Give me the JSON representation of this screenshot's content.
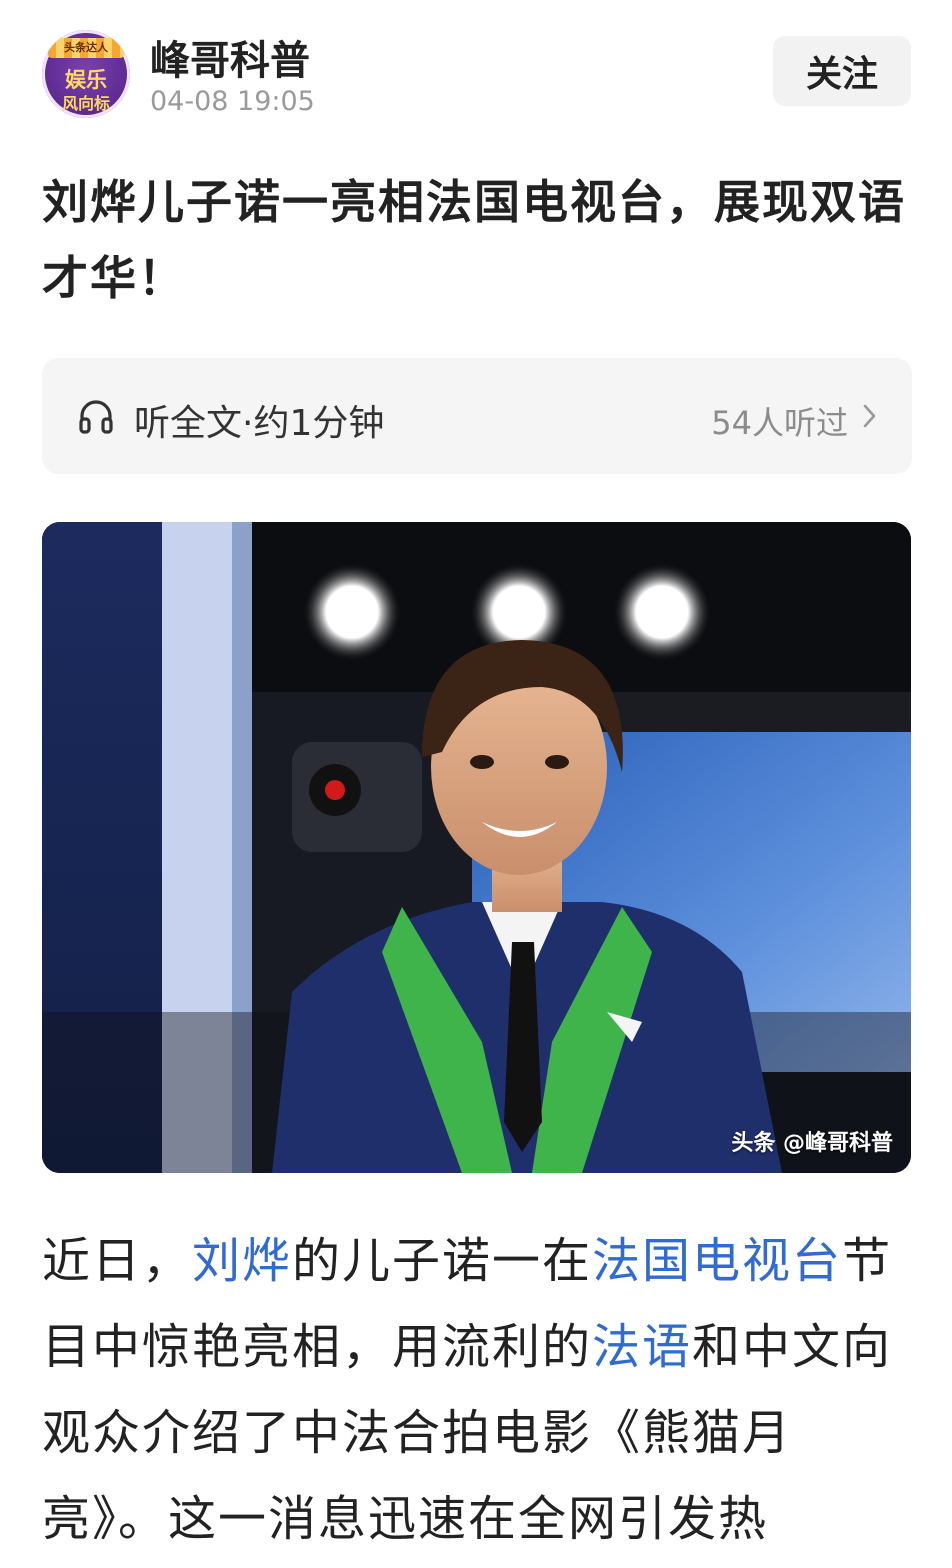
{
  "author": {
    "name": "峰哥科普",
    "time": "04-08 19:05",
    "avatar_ribbon": "头条达人",
    "avatar_line1": "娱乐",
    "avatar_line2": "风向标"
  },
  "follow_label": "关注",
  "title": "刘烨儿子诺一亮相法国电视台，展现双语才华！",
  "listen": {
    "label": "听全文·约1分钟",
    "count": "54人听过"
  },
  "hero_image": {
    "watermark": "头条 @峰哥科普"
  },
  "article": {
    "segments": [
      {
        "text": "近日，",
        "link": false
      },
      {
        "text": "刘烨",
        "link": true
      },
      {
        "text": "的儿子诺一在",
        "link": false
      },
      {
        "text": "法国电视台",
        "link": true
      },
      {
        "text": "节目中惊艳亮相，用流利的",
        "link": false
      },
      {
        "text": "法语",
        "link": true
      },
      {
        "text": "和中文向观众介绍了中法合拍电影《熊猫月亮》。这一消息迅速在全网引发热",
        "link": false
      }
    ]
  },
  "colors": {
    "link": "#2f6bd3",
    "follow_bg": "#f2f2f2",
    "listen_bg": "#f5f5f5",
    "meta_gray": "#9a9a9a"
  },
  "icons": [
    "headphone-icon",
    "chevron-right-icon"
  ]
}
